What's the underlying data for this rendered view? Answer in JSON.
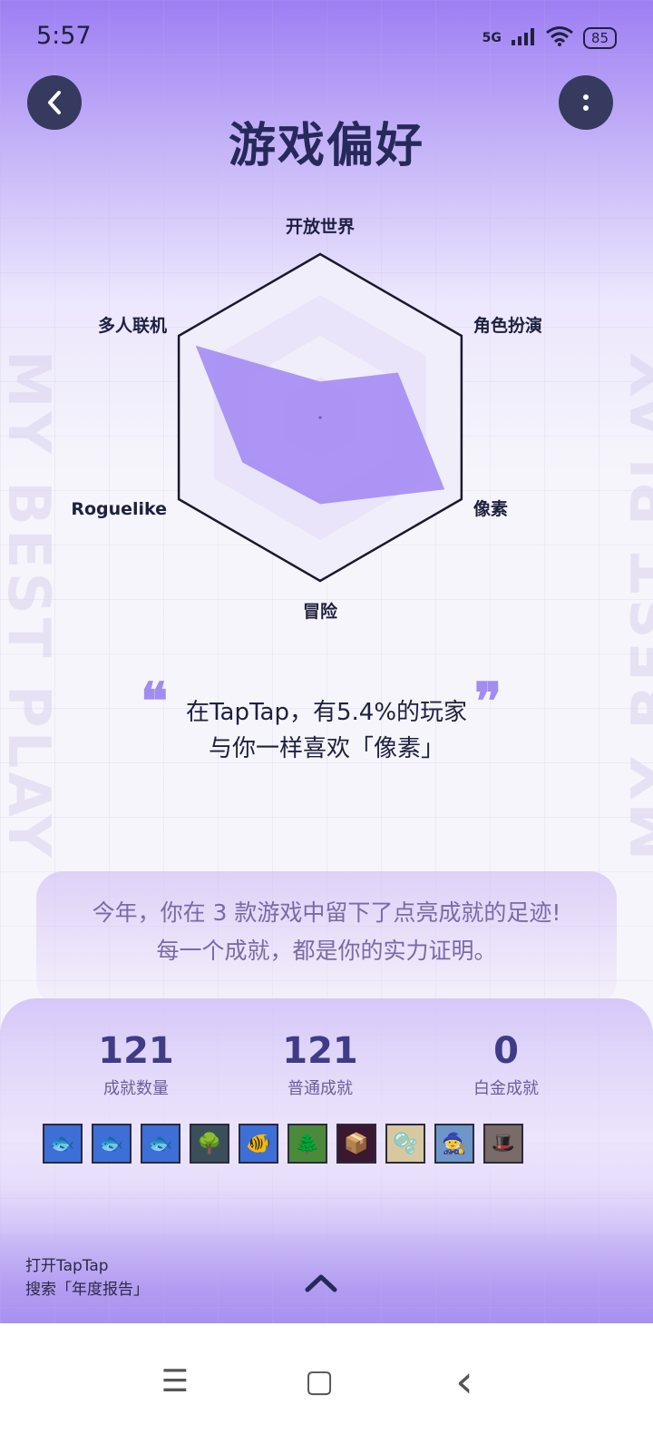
{
  "status_bar": {
    "time": "5:57",
    "network": "5G",
    "battery": "85"
  },
  "header": {
    "title": "游戏偏好"
  },
  "radar": {
    "labels": [
      "开放世界",
      "角色扮演",
      "像素",
      "冒险",
      "Roguelike",
      "多人联机"
    ],
    "values": [
      0.22,
      0.55,
      0.88,
      0.53,
      0.55,
      0.88
    ]
  },
  "quote": {
    "line1": "在TapTap，有5.4%的玩家",
    "line2": "与你一样喜欢「像素」",
    "open_mark": "❝",
    "close_mark": "❞"
  },
  "achievements": {
    "line1": "今年，你在 3 款游戏中留下了点亮成就的足迹!",
    "line2": "每一个成就，都是你的实力证明。",
    "stats": [
      {
        "value": "121",
        "label": "成就数量"
      },
      {
        "value": "121",
        "label": "普通成就"
      },
      {
        "value": "0",
        "label": "白金成就"
      }
    ],
    "badges": [
      {
        "icon": "orange-fish-icon",
        "bg": "#3d6fd6",
        "glyph": "🐟"
      },
      {
        "icon": "green-fish-icon",
        "bg": "#3d6fd6",
        "glyph": "🐟"
      },
      {
        "icon": "teal-fish-icon",
        "bg": "#3d6fd6",
        "glyph": "🐟"
      },
      {
        "icon": "tree-face-icon",
        "bg": "#3b4f5a",
        "glyph": "🌳"
      },
      {
        "icon": "skeleton-fish-icon",
        "bg": "#3d6fd6",
        "glyph": "🐠"
      },
      {
        "icon": "tree-icon",
        "bg": "#4b8a3b",
        "glyph": "🌲"
      },
      {
        "icon": "treasure-chest-icon",
        "bg": "#3a1830",
        "glyph": "📦"
      },
      {
        "icon": "slime-icon",
        "bg": "#d8c8a0",
        "glyph": "🫧"
      },
      {
        "icon": "gnome-icon",
        "bg": "#6e96c8",
        "glyph": "🧙"
      },
      {
        "icon": "hat-character-icon",
        "bg": "#7a6a68",
        "glyph": "🎩"
      }
    ]
  },
  "footer": {
    "hint_line1": "打开TapTap",
    "hint_line2": "搜索「年度报告」"
  },
  "navbar": {
    "menu": "☰",
    "home": "▢",
    "back": "‹"
  }
}
